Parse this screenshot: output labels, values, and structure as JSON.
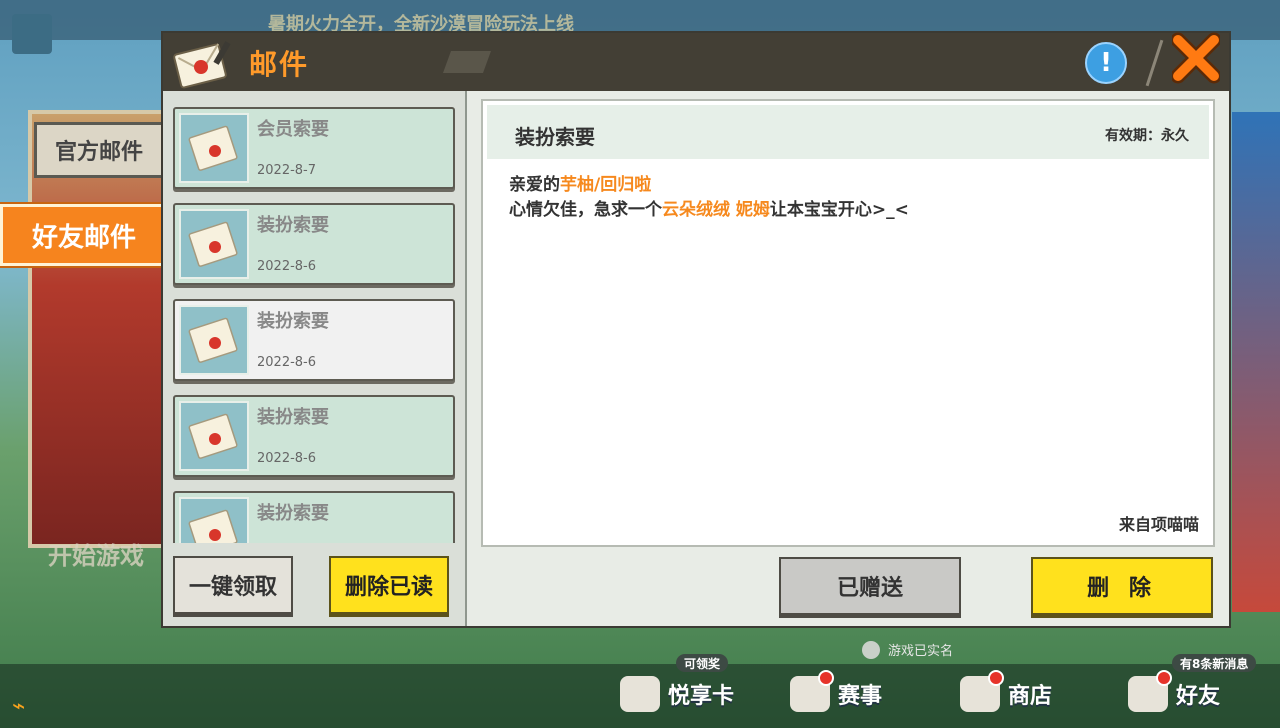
{
  "background": {
    "banner_text": "暑期火力全开，全新沙漠冒险玩法上线",
    "start_game_text": "开始游戏",
    "verified_text": "游戏已实名"
  },
  "side_tabs": [
    {
      "label": "官方邮件",
      "active": false
    },
    {
      "label": "好友邮件",
      "active": true
    }
  ],
  "mail": {
    "title": "邮件",
    "info_icon": "info-icon",
    "close_icon": "close-icon",
    "list": [
      {
        "subject": "会员索要",
        "date": "2022-8-7",
        "selected": false
      },
      {
        "subject": "装扮索要",
        "date": "2022-8-6",
        "selected": false
      },
      {
        "subject": "装扮索要",
        "date": "2022-8-6",
        "selected": true
      },
      {
        "subject": "装扮索要",
        "date": "2022-8-6",
        "selected": false
      },
      {
        "subject": "装扮索要",
        "date": "",
        "selected": false
      }
    ],
    "claim_all_label": "一键领取",
    "delete_read_label": "删除已读",
    "detail": {
      "title": "装扮索要",
      "expiry": "有效期：永久",
      "greeting_prefix": "亲爱的",
      "recipient": "芋柚/回归啦",
      "line2_prefix": "心情欠佳，急求一个",
      "item_name": "云朵绒绒 妮姆",
      "line2_suffix": "让本宝宝开心>_<",
      "from": "来自项喵喵"
    },
    "gifted_label": "已赠送",
    "delete_label": "删 除"
  },
  "bottom_nav": [
    {
      "label": "悦享卡",
      "badge": "可领奖",
      "icon": "pig-card-icon",
      "red_dot": false
    },
    {
      "label": "赛事",
      "badge": "",
      "icon": "trophy-icon",
      "red_dot": true
    },
    {
      "label": "商店",
      "badge": "",
      "icon": "cart-icon",
      "red_dot": true
    },
    {
      "label": "好友",
      "badge": "有8条新消息",
      "icon": "friend-icon",
      "red_dot": true
    }
  ],
  "colors": {
    "accent_orange": "#f6841e",
    "button_yellow": "#ffe11d",
    "header_dark": "#433f35",
    "info_blue": "#3d9fe2"
  }
}
